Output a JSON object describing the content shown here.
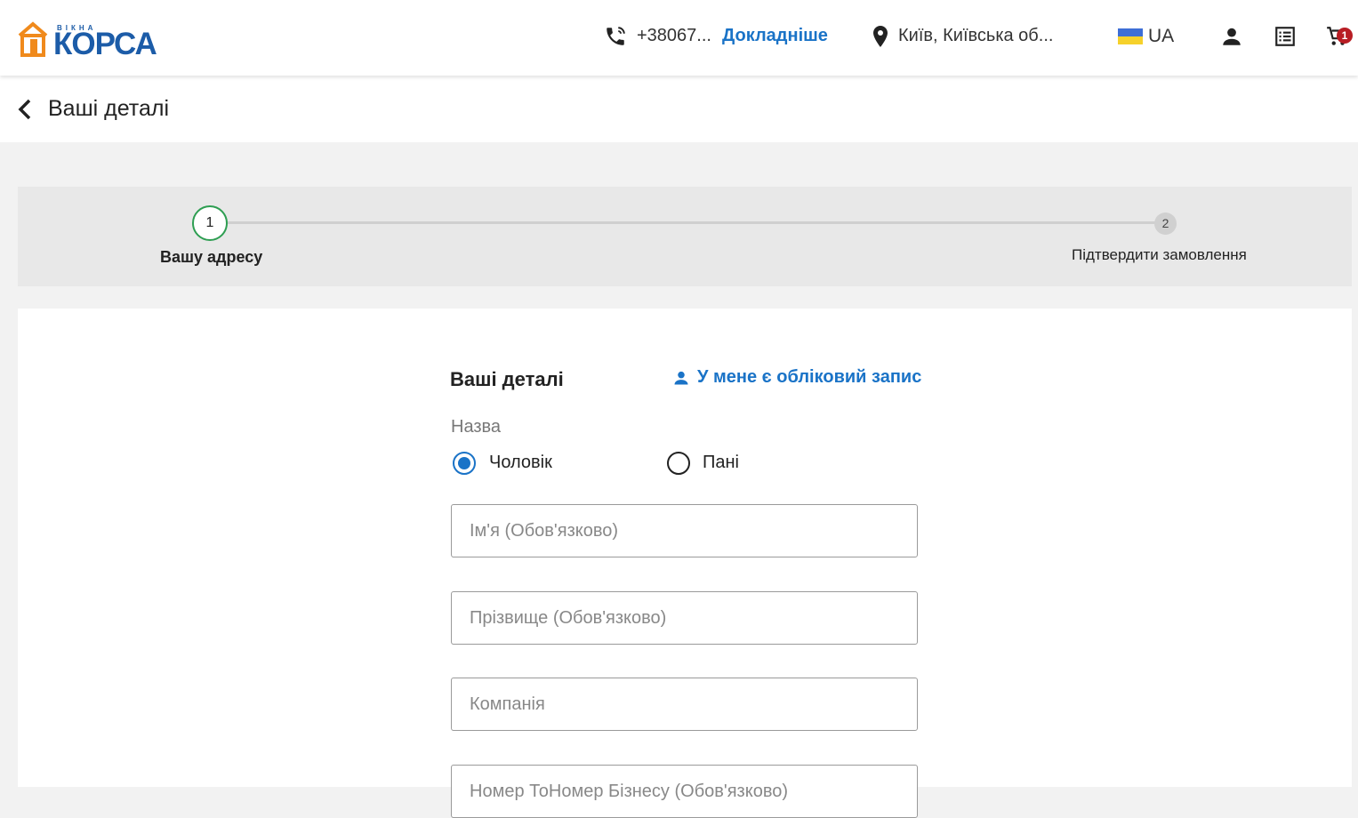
{
  "header": {
    "logo_small": "ВІКНА",
    "logo_big": "КОРСА",
    "phone": "+38067...",
    "details_link": "Докладніше",
    "city": "Київ, Київська об...",
    "lang": "UA",
    "cart_count": "1"
  },
  "subheader": {
    "title": "Ваші деталі"
  },
  "stepper": {
    "steps": [
      {
        "number": "1",
        "label": "Вашу адресу"
      },
      {
        "number": "2",
        "label": "Підтвердити замовлення"
      }
    ]
  },
  "form": {
    "title": "Ваші деталі",
    "account_link": "У мене є обліковий запис",
    "salutation_label": "Назва",
    "salutation_options": [
      {
        "label": "Чоловік",
        "checked": true
      },
      {
        "label": "Пані",
        "checked": false
      }
    ],
    "first_name_placeholder": "Ім'я (Обов'язково)",
    "last_name_placeholder": "Прізвище (Обов'язково)",
    "company_placeholder": "Компанія",
    "vat_placeholder": "Номер ТоНомер Бізнесу (Обов'язково)"
  },
  "colors": {
    "accent": "#1a73c7",
    "brand": "#1c5ca8",
    "logo_orange": "#f08a1c",
    "step_active": "#2e9e52",
    "badge": "#b81d24"
  }
}
